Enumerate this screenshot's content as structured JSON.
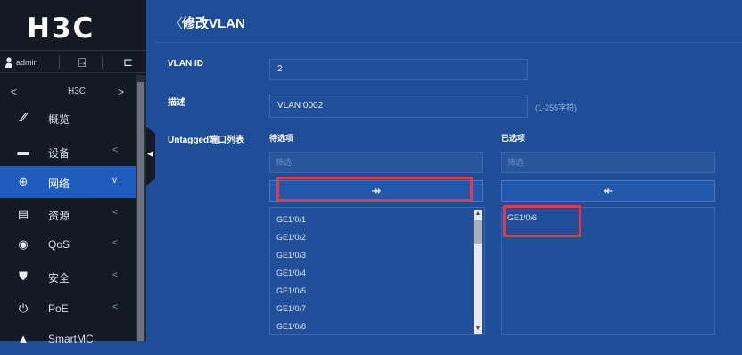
{
  "brand": {
    "logo": "H3C"
  },
  "user": {
    "name": "admin"
  },
  "device_nav": {
    "prev": "<",
    "name": "H3C",
    "next": ">"
  },
  "menu": [
    {
      "label": "概览",
      "icon": "speedometer-icon",
      "arrow": ""
    },
    {
      "label": "设备",
      "icon": "device-icon",
      "arrow": "<"
    },
    {
      "label": "网络",
      "icon": "globe-icon",
      "arrow": "v",
      "active": true
    },
    {
      "label": "资源",
      "icon": "database-icon",
      "arrow": "<"
    },
    {
      "label": "QoS",
      "icon": "qos-icon",
      "arrow": "<"
    },
    {
      "label": "安全",
      "icon": "shield-icon",
      "arrow": "<"
    },
    {
      "label": "PoE",
      "icon": "power-icon",
      "arrow": "<"
    },
    {
      "label": "SmartMC",
      "icon": "smartmc-icon",
      "arrow": ""
    }
  ],
  "page": {
    "back": "〈",
    "title": "修改VLAN"
  },
  "form": {
    "vlan_id_label": "VLAN ID",
    "vlan_id_value": "2",
    "desc_label": "描述",
    "desc_value": "VLAN 0002",
    "desc_hint": "(1-255字符)",
    "untagged_label": "Untagged端口列表"
  },
  "transfer": {
    "candidates_title": "待选项",
    "selected_title": "已选项",
    "filter_placeholder": "筛选",
    "add_arrow": "↠",
    "remove_arrow": "↞",
    "candidates": [
      "GE1/0/1",
      "GE1/0/2",
      "GE1/0/3",
      "GE1/0/4",
      "GE1/0/5",
      "GE1/0/7",
      "GE1/0/8"
    ],
    "selected": [
      "GE1/0/6"
    ]
  },
  "colors": {
    "accent": "#1e5cbd",
    "highlight": "#e03b46",
    "background": "#1f4d98"
  }
}
